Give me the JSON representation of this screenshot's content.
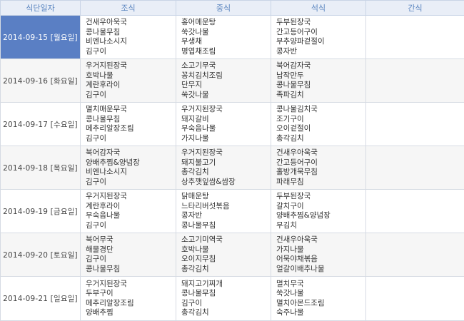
{
  "headers": {
    "date": "식단일자",
    "breakfast": "조식",
    "lunch": "중식",
    "dinner": "석식",
    "snack": "간식"
  },
  "days": [
    {
      "date": "2014-09-15 [월요일]",
      "selected": true,
      "breakfast": [
        "건새우아욱국",
        "콩나물무침",
        "비엔나소시지",
        "김구이"
      ],
      "lunch": [
        "홍어메운탕",
        "쑥갓나물",
        "무생채",
        "명엽채조림"
      ],
      "dinner": [
        "두부된장국",
        "간고등어구이",
        "부추양파겉절이",
        "콩자반"
      ],
      "snack": []
    },
    {
      "date": "2014-09-16 [화요일]",
      "breakfast": [
        "우거지된장국",
        "호박나물",
        "계란후라이",
        "김구이"
      ],
      "lunch": [
        "소고기무국",
        "꽁치김치조림",
        "단무지",
        "쑥갓나물"
      ],
      "dinner": [
        "북어감자국",
        "납작만두",
        "콩나물무침",
        "족파김치"
      ],
      "snack": []
    },
    {
      "date": "2014-09-17 [수요일]",
      "breakfast": [
        "멸치매운무국",
        "콩나물무침",
        "메추리알장조림",
        "김구이"
      ],
      "lunch": [
        "우거지된장국",
        "돼지갈비",
        "무숙음나물",
        "가지나물"
      ],
      "dinner": [
        "콩나물김치국",
        "조기구이",
        "오이겉절이",
        "총각김치"
      ],
      "snack": []
    },
    {
      "date": "2014-09-18 [목요일]",
      "breakfast": [
        "북어감자국",
        "양배추찜&양념장",
        "비엔나소시지",
        "김구이"
      ],
      "lunch": [
        "우거지된장국",
        "돼지불고기",
        "총각김치",
        "상추깻잎쌈&쌈장"
      ],
      "dinner": [
        "건새우아욱국",
        "간고등어구이",
        "홀방개묵무침",
        "파래무침"
      ],
      "snack": []
    },
    {
      "date": "2014-09-19 [금요일]",
      "breakfast": [
        "우거지된장국",
        "계란후라이",
        "무숙음나물",
        "김구이"
      ],
      "lunch": [
        "닭매운탕",
        "느타리버섯볶음",
        "콩자반",
        "콩나물무침"
      ],
      "dinner": [
        "두부된장국",
        "갈치구이",
        "양배추찜&양념장",
        "무김치"
      ],
      "snack": []
    },
    {
      "date": "2014-09-20 [토요일]",
      "breakfast": [
        "북어무국",
        "해물경단",
        "김구이",
        "콩나물무침"
      ],
      "lunch": [
        "소고기미역국",
        "호박나물",
        "오이지무침",
        "총각김치"
      ],
      "dinner": [
        "건새우아욱국",
        "가지나물",
        "어묵야채볶음",
        "얼갈이배추나물"
      ],
      "snack": []
    },
    {
      "date": "2014-09-21 [일요일]",
      "breakfast": [
        "우거지된장국",
        "두부구이",
        "메추리알장조림",
        "양배추찜"
      ],
      "lunch": [
        "돼지고기찌개",
        "콩나물무침",
        "김구이",
        "총각김치"
      ],
      "dinner": [
        "멸치무국",
        "쑥갓나물",
        "멸치아몬드조림",
        "숙주나물"
      ],
      "snack": []
    }
  ]
}
